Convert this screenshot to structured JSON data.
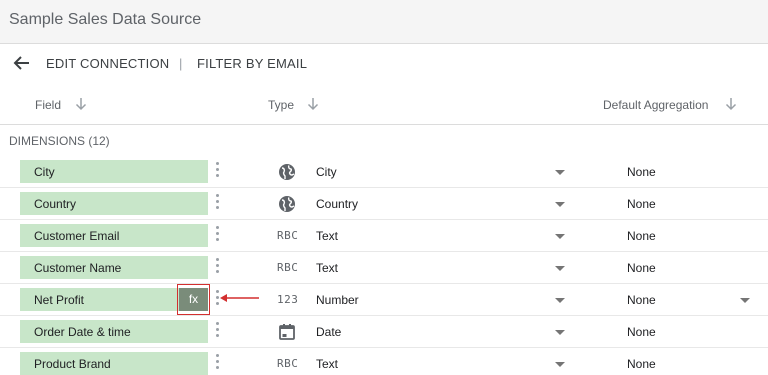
{
  "app": {
    "title": "Sample Sales Data Source"
  },
  "toolbar": {
    "edit_connection": "EDIT CONNECTION",
    "separator": "|",
    "filter_by_email": "FILTER BY EMAIL"
  },
  "columns": {
    "field": "Field",
    "type": "Type",
    "default_aggregation": "Default Aggregation"
  },
  "section": {
    "label": "DIMENSIONS (12)"
  },
  "rows": [
    {
      "field": "City",
      "type": "City",
      "type_icon": "globe-icon",
      "aggregation": "None"
    },
    {
      "field": "Country",
      "type": "Country",
      "type_icon": "globe-icon",
      "aggregation": "None"
    },
    {
      "field": "Customer Email",
      "type": "Text",
      "type_icon": "abc-icon",
      "type_icon_text": "RBC",
      "aggregation": "None"
    },
    {
      "field": "Customer Name",
      "type": "Text",
      "type_icon": "abc-icon",
      "type_icon_text": "RBC",
      "aggregation": "None"
    },
    {
      "field": "Net Profit",
      "type": "Number",
      "type_icon": "number-icon",
      "type_icon_text": "123",
      "aggregation": "None",
      "fx_label": "fx"
    },
    {
      "field": "Order Date & time",
      "type": "Date",
      "type_icon": "calendar-icon",
      "aggregation": "None"
    },
    {
      "field": "Product Brand",
      "type": "Text",
      "type_icon": "abc-icon",
      "type_icon_text": "RBC",
      "aggregation": "None"
    }
  ],
  "colors": {
    "chip_bg": "#c8e6c9",
    "fx_bg": "#7a8c7a",
    "highlight": "#d32f2f"
  }
}
